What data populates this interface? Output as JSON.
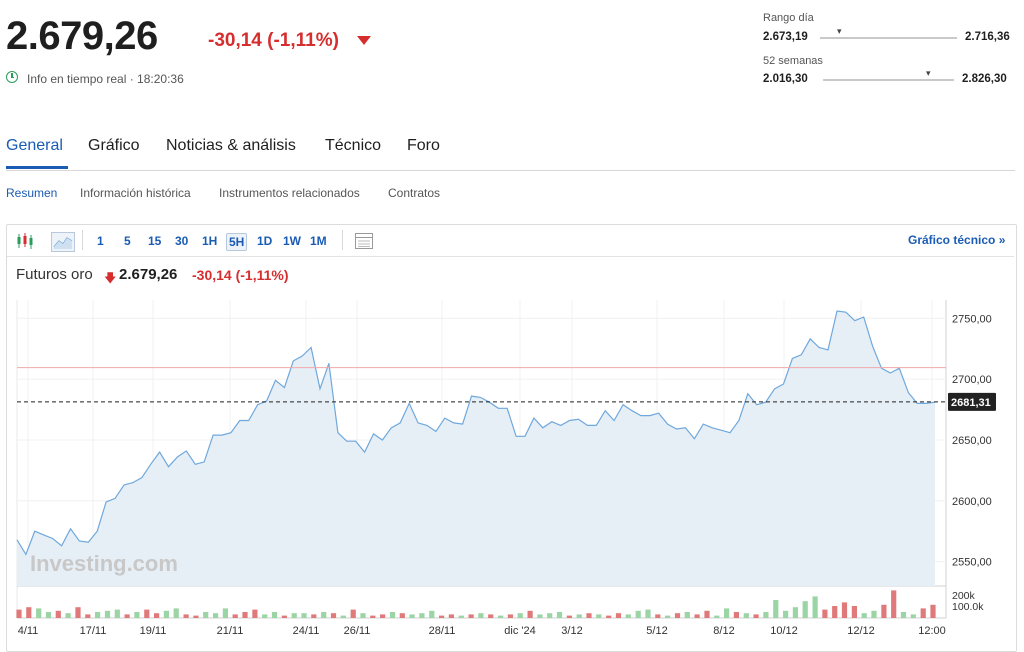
{
  "header": {
    "price": "2.679,26",
    "change": "-30,14",
    "change_pct": "(-1,11%)",
    "realtime": "Info en tiempo real · 18:20:36",
    "day_range": {
      "title": "Rango día",
      "low": "2.673,19",
      "high": "2.716,36"
    },
    "week52_range": {
      "title": "52 semanas",
      "low": "2.016,30",
      "high": "2.826,30"
    }
  },
  "tabs": [
    {
      "label": "General"
    },
    {
      "label": "Gráfico"
    },
    {
      "label": "Noticias & análisis"
    },
    {
      "label": "Técnico"
    },
    {
      "label": "Foro"
    }
  ],
  "subtabs": [
    {
      "label": "Resumen"
    },
    {
      "label": "Información histórica"
    },
    {
      "label": "Instrumentos relacionados"
    },
    {
      "label": "Contratos"
    }
  ],
  "toolbar": {
    "intervals": [
      "1",
      "5",
      "15",
      "30",
      "1H",
      "5H",
      "1D",
      "1W",
      "1M"
    ],
    "selected_interval": "5H",
    "technical_link": "Gráfico técnico »"
  },
  "chart_header": {
    "name": "Futuros oro",
    "price": "2.679,26",
    "change": "-30,14",
    "change_pct": "(-1,11%)"
  },
  "colors": {
    "accent": "#1a5bb4",
    "negative": "#d62e2e",
    "positive": "#2a9d5c",
    "line": "#6fa8dc",
    "area": "#e6eef6"
  },
  "chart_data": {
    "type": "area",
    "watermark": "Investing.com",
    "current_label": "2681,31",
    "current_value": 2681.31,
    "prev_close": 2709.4,
    "ylim": [
      2530,
      2765
    ],
    "y_ticks": [
      2550,
      2600,
      2650,
      2700,
      2750
    ],
    "y_tick_labels": [
      "2550,00",
      "2600,00",
      "2650,00",
      "2700,00",
      "2750,00"
    ],
    "x_labels": [
      "4/11",
      "17/11",
      "19/11",
      "21/11",
      "24/11",
      "26/11",
      "28/11",
      "dic '24",
      "3/12",
      "5/12",
      "8/12",
      "10/12",
      "12/12",
      "12:00"
    ],
    "volume_labels": [
      "200k",
      "100.0k"
    ],
    "values": [
      2568,
      2556,
      2575,
      2572,
      2569,
      2563,
      2577,
      2567,
      2566,
      2575,
      2599,
      2602,
      2613,
      2615,
      2619,
      2630,
      2640,
      2628,
      2636,
      2641,
      2630,
      2632,
      2654,
      2654,
      2656,
      2666,
      2666,
      2679,
      2682,
      2699,
      2693,
      2715,
      2719,
      2726,
      2692,
      2713,
      2656,
      2649,
      2649,
      2640,
      2655,
      2650,
      2660,
      2664,
      2680,
      2664,
      2662,
      2657,
      2668,
      2664,
      2663,
      2686,
      2685,
      2681,
      2676,
      2676,
      2653,
      2653,
      2668,
      2660,
      2665,
      2662,
      2666,
      2667,
      2662,
      2662,
      2674,
      2666,
      2679,
      2674,
      2670,
      2670,
      2672,
      2663,
      2659,
      2660,
      2651,
      2663,
      2660,
      2658,
      2656,
      2666,
      2688,
      2679,
      2681,
      2692,
      2696,
      2717,
      2720,
      2733,
      2726,
      2724,
      2756,
      2755,
      2748,
      2751,
      2727,
      2709,
      2705,
      2709,
      2689,
      2680,
      2680,
      2681
    ],
    "volume": [
      {
        "v": 14,
        "up": false
      },
      {
        "v": 18,
        "up": false
      },
      {
        "v": 16,
        "up": true
      },
      {
        "v": 10,
        "up": true
      },
      {
        "v": 12,
        "up": false
      },
      {
        "v": 8,
        "up": true
      },
      {
        "v": 18,
        "up": false
      },
      {
        "v": 6,
        "up": false
      },
      {
        "v": 10,
        "up": true
      },
      {
        "v": 12,
        "up": true
      },
      {
        "v": 14,
        "up": true
      },
      {
        "v": 6,
        "up": false
      },
      {
        "v": 10,
        "up": true
      },
      {
        "v": 14,
        "up": false
      },
      {
        "v": 8,
        "up": false
      },
      {
        "v": 12,
        "up": true
      },
      {
        "v": 16,
        "up": true
      },
      {
        "v": 6,
        "up": false
      },
      {
        "v": 4,
        "up": false
      },
      {
        "v": 10,
        "up": true
      },
      {
        "v": 8,
        "up": true
      },
      {
        "v": 16,
        "up": true
      },
      {
        "v": 6,
        "up": false
      },
      {
        "v": 10,
        "up": false
      },
      {
        "v": 14,
        "up": false
      },
      {
        "v": 6,
        "up": true
      },
      {
        "v": 10,
        "up": true
      },
      {
        "v": 4,
        "up": false
      },
      {
        "v": 8,
        "up": true
      },
      {
        "v": 8,
        "up": true
      },
      {
        "v": 6,
        "up": false
      },
      {
        "v": 10,
        "up": true
      },
      {
        "v": 8,
        "up": false
      },
      {
        "v": 4,
        "up": true
      },
      {
        "v": 14,
        "up": false
      },
      {
        "v": 8,
        "up": true
      },
      {
        "v": 4,
        "up": false
      },
      {
        "v": 6,
        "up": false
      },
      {
        "v": 10,
        "up": true
      },
      {
        "v": 8,
        "up": false
      },
      {
        "v": 6,
        "up": true
      },
      {
        "v": 8,
        "up": true
      },
      {
        "v": 12,
        "up": true
      },
      {
        "v": 4,
        "up": false
      },
      {
        "v": 6,
        "up": false
      },
      {
        "v": 4,
        "up": true
      },
      {
        "v": 6,
        "up": false
      },
      {
        "v": 8,
        "up": true
      },
      {
        "v": 6,
        "up": false
      },
      {
        "v": 4,
        "up": true
      },
      {
        "v": 6,
        "up": false
      },
      {
        "v": 8,
        "up": true
      },
      {
        "v": 12,
        "up": false
      },
      {
        "v": 6,
        "up": true
      },
      {
        "v": 8,
        "up": true
      },
      {
        "v": 10,
        "up": true
      },
      {
        "v": 4,
        "up": false
      },
      {
        "v": 6,
        "up": true
      },
      {
        "v": 8,
        "up": false
      },
      {
        "v": 6,
        "up": true
      },
      {
        "v": 4,
        "up": false
      },
      {
        "v": 8,
        "up": false
      },
      {
        "v": 6,
        "up": true
      },
      {
        "v": 12,
        "up": true
      },
      {
        "v": 14,
        "up": true
      },
      {
        "v": 6,
        "up": false
      },
      {
        "v": 4,
        "up": true
      },
      {
        "v": 8,
        "up": false
      },
      {
        "v": 10,
        "up": true
      },
      {
        "v": 6,
        "up": false
      },
      {
        "v": 12,
        "up": false
      },
      {
        "v": 4,
        "up": true
      },
      {
        "v": 16,
        "up": true
      },
      {
        "v": 10,
        "up": false
      },
      {
        "v": 8,
        "up": true
      },
      {
        "v": 6,
        "up": false
      },
      {
        "v": 10,
        "up": true
      },
      {
        "v": 30,
        "up": true
      },
      {
        "v": 12,
        "up": true
      },
      {
        "v": 18,
        "up": true
      },
      {
        "v": 28,
        "up": true
      },
      {
        "v": 36,
        "up": true
      },
      {
        "v": 14,
        "up": false
      },
      {
        "v": 20,
        "up": false
      },
      {
        "v": 26,
        "up": false
      },
      {
        "v": 20,
        "up": false
      },
      {
        "v": 8,
        "up": true
      },
      {
        "v": 12,
        "up": true
      },
      {
        "v": 22,
        "up": false
      },
      {
        "v": 46,
        "up": false
      },
      {
        "v": 10,
        "up": true
      },
      {
        "v": 6,
        "up": true
      },
      {
        "v": 16,
        "up": false
      },
      {
        "v": 22,
        "up": false
      }
    ]
  }
}
